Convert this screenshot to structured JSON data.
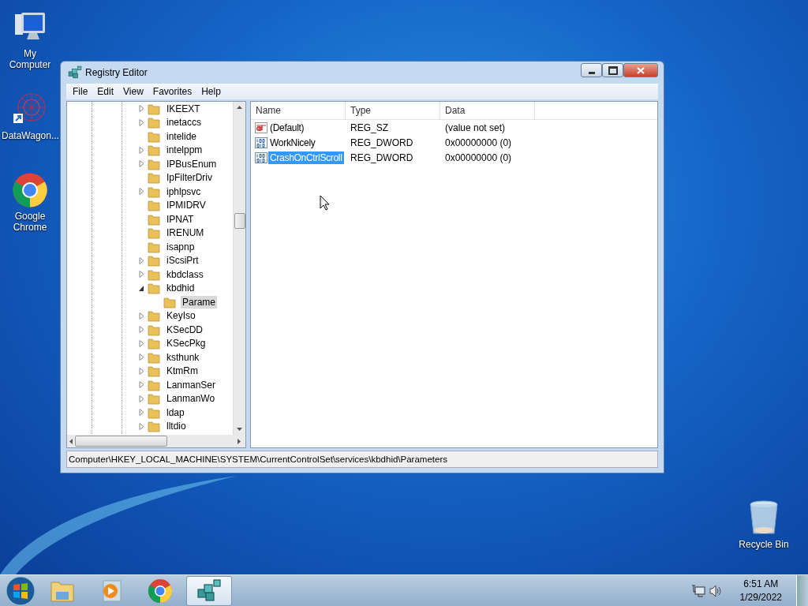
{
  "desktop_icons": [
    {
      "label": "My Computer",
      "kind": "computer"
    },
    {
      "label": "DataWagon...",
      "kind": "datawagon"
    },
    {
      "label": "Google Chrome",
      "kind": "chrome"
    },
    {
      "label": "Recycle Bin",
      "kind": "recycle"
    }
  ],
  "window": {
    "title": "Registry Editor"
  },
  "menu": [
    "File",
    "Edit",
    "View",
    "Favorites",
    "Help"
  ],
  "tree": [
    {
      "label": "IKEEXT",
      "expandable": true,
      "expanded": false,
      "selected": false
    },
    {
      "label": "inetaccs",
      "expandable": true,
      "expanded": false,
      "selected": false
    },
    {
      "label": "intelide",
      "expandable": false,
      "expanded": false,
      "selected": false
    },
    {
      "label": "intelppm",
      "expandable": true,
      "expanded": false,
      "selected": false
    },
    {
      "label": "IPBusEnum",
      "expandable": true,
      "expanded": false,
      "selected": false
    },
    {
      "label": "IpFilterDriv",
      "expandable": false,
      "expanded": false,
      "selected": false
    },
    {
      "label": "iphlpsvc",
      "expandable": true,
      "expanded": false,
      "selected": false
    },
    {
      "label": "IPMIDRV",
      "expandable": false,
      "expanded": false,
      "selected": false
    },
    {
      "label": "IPNAT",
      "expandable": false,
      "expanded": false,
      "selected": false
    },
    {
      "label": "IRENUM",
      "expandable": false,
      "expanded": false,
      "selected": false
    },
    {
      "label": "isapnp",
      "expandable": false,
      "expanded": false,
      "selected": false
    },
    {
      "label": "iScsiPrt",
      "expandable": true,
      "expanded": false,
      "selected": false
    },
    {
      "label": "kbdclass",
      "expandable": true,
      "expanded": false,
      "selected": false
    },
    {
      "label": "kbdhid",
      "expandable": true,
      "expanded": true,
      "selected": false,
      "children": [
        {
          "label": "Parame",
          "expandable": false,
          "expanded": false,
          "selected": true
        }
      ]
    },
    {
      "label": "KeyIso",
      "expandable": true,
      "expanded": false,
      "selected": false
    },
    {
      "label": "KSecDD",
      "expandable": true,
      "expanded": false,
      "selected": false
    },
    {
      "label": "KSecPkg",
      "expandable": true,
      "expanded": false,
      "selected": false
    },
    {
      "label": "ksthunk",
      "expandable": true,
      "expanded": false,
      "selected": false
    },
    {
      "label": "KtmRm",
      "expandable": true,
      "expanded": false,
      "selected": false
    },
    {
      "label": "LanmanSer",
      "expandable": true,
      "expanded": false,
      "selected": false
    },
    {
      "label": "LanmanWo",
      "expandable": true,
      "expanded": false,
      "selected": false
    },
    {
      "label": "ldap",
      "expandable": true,
      "expanded": false,
      "selected": false
    },
    {
      "label": "lltdio",
      "expandable": true,
      "expanded": false,
      "selected": false
    }
  ],
  "columns": [
    "Name",
    "Type",
    "Data"
  ],
  "values": [
    {
      "kind": "string",
      "name": "(Default)",
      "type": "REG_SZ",
      "data": "(value not set)",
      "selected": false
    },
    {
      "kind": "binary",
      "name": "WorkNicely",
      "type": "REG_DWORD",
      "data": "0x00000000 (0)",
      "selected": false
    },
    {
      "kind": "binary",
      "name": "CrashOnCtrlScroll",
      "type": "REG_DWORD",
      "data": "0x00000000 (0)",
      "selected": true
    }
  ],
  "status_bar": "Computer\\HKEY_LOCAL_MACHINE\\SYSTEM\\CurrentControlSet\\services\\kbdhid\\Parameters",
  "taskbar": [
    {
      "kind": "explorer",
      "active": false
    },
    {
      "kind": "media",
      "active": false
    },
    {
      "kind": "chrome",
      "active": false
    },
    {
      "kind": "regedit",
      "active": true
    }
  ],
  "clock": {
    "time": "6:51 AM",
    "date": "1/29/2022"
  }
}
